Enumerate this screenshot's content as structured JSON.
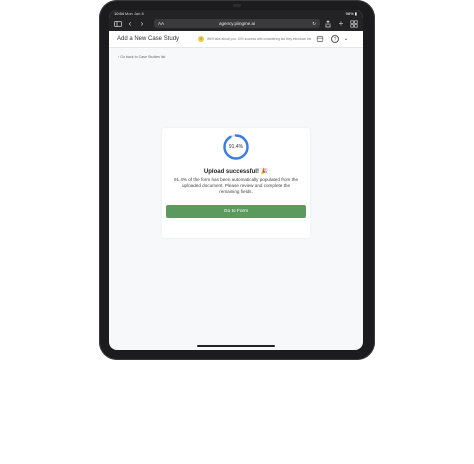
{
  "status_bar": {
    "time": "10:54",
    "date": "Mon Jan 8",
    "battery": "98% ▮"
  },
  "browser": {
    "reader_label": "AA",
    "url": "agency.piingme.ai",
    "lock_icon": "lock-icon",
    "reload_icon": "reload-icon"
  },
  "header": {
    "title": "Add a New Case Study",
    "notice_icon": "!",
    "notice_text": "We'll take about you: 10% success with considering but they introduce them",
    "icons": [
      "grid-icon",
      "help-icon",
      "chevron-down-icon"
    ]
  },
  "back_link": {
    "label": "‹  Go back to Case Studies list"
  },
  "upload": {
    "progress_percent": 91.4,
    "progress_label": "91.4%",
    "title": "Upload successful! 🎉",
    "description": "91.4% of the form has been automatically populated from the uploaded document. Please review and complete the remaining fields.",
    "button_label": "Go to Form"
  },
  "colors": {
    "accent_blue": "#3d7de0",
    "button_green": "#5b9a5e",
    "browser_chrome": "#232325",
    "page_bg": "#f7f8fa"
  }
}
